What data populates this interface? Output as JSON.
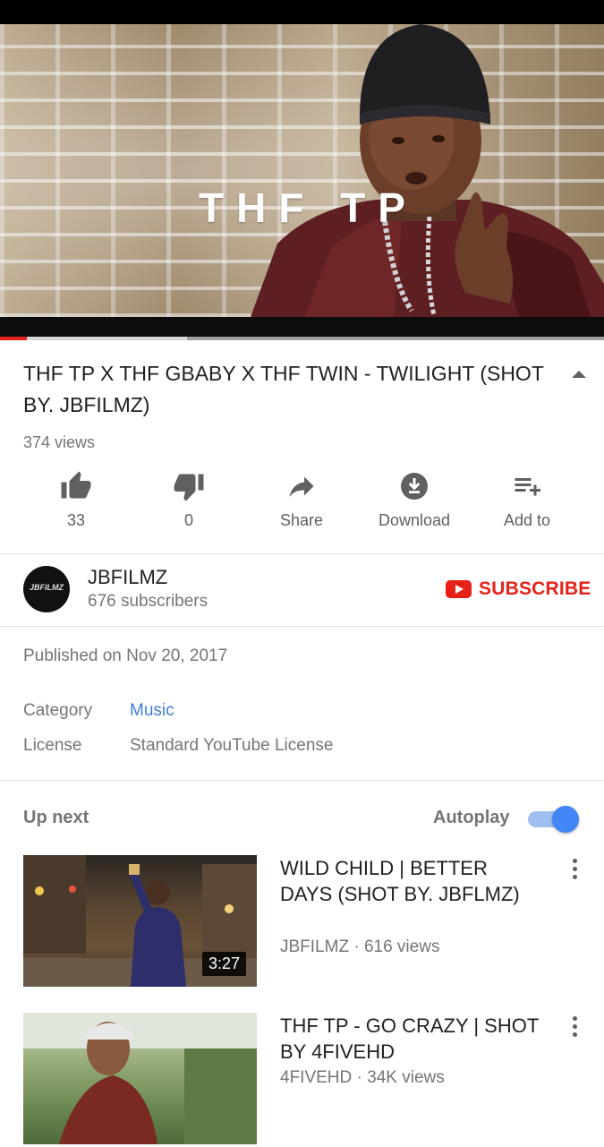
{
  "video": {
    "overlay_text": "THF TP",
    "progress_played": 0.045,
    "progress_buffered": 0.31
  },
  "title": "THF TP X THF GBABY X THF TWIN - TWILIGHT (SHOT BY. JBFILMZ)",
  "views": "374 views",
  "actions": {
    "like_count": "33",
    "dislike_count": "0",
    "share_label": "Share",
    "download_label": "Download",
    "add_label": "Add to"
  },
  "channel": {
    "avatar_text": "JBFILMZ",
    "name": "JBFILMZ",
    "subscribers": "676 subscribers",
    "subscribe_label": "SUBSCRIBE"
  },
  "details": {
    "published": "Published on Nov 20, 2017",
    "category_label": "Category",
    "category_value": "Music",
    "license_label": "License",
    "license_value": "Standard YouTube License"
  },
  "up_next": {
    "heading": "Up next",
    "autoplay_label": "Autoplay",
    "autoplay_on": true,
    "videos": [
      {
        "title": "WILD CHILD | BETTER DAYS (SHOT BY. JBFLMZ)",
        "channel": "JBFILMZ",
        "views": "616 views",
        "duration": "3:27"
      },
      {
        "title": "THF TP - GO CRAZY | SHOT BY 4FIVEHD",
        "channel": "4FIVEHD",
        "views": "34K views",
        "duration": ""
      }
    ]
  },
  "colors": {
    "accent_red": "#e62117",
    "link_blue": "#3e7ed8",
    "toggle_blue": "#4285f4"
  }
}
